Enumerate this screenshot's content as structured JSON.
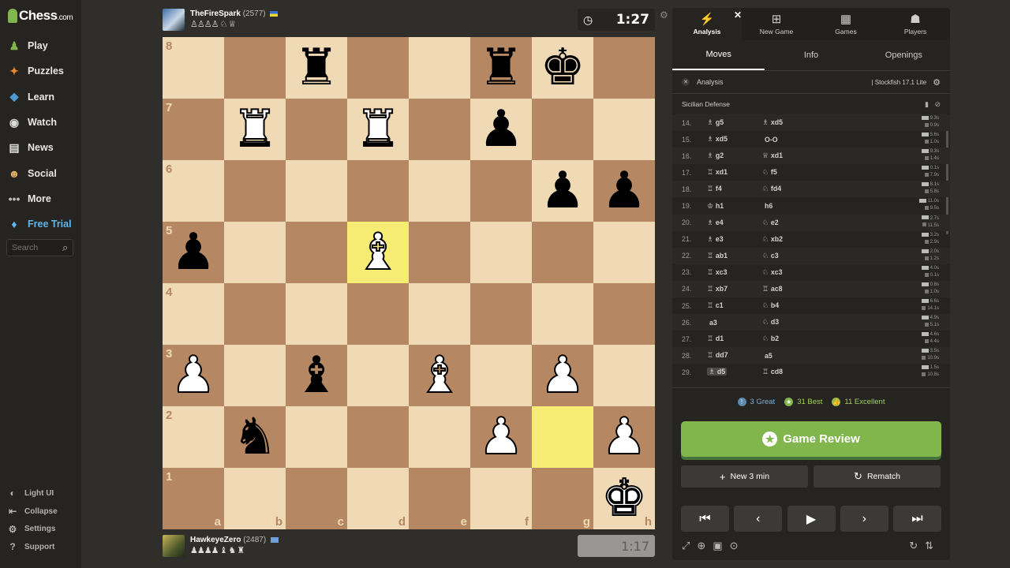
{
  "sidebar": {
    "logo": "Chess",
    "logo_domain": ".com",
    "items": [
      {
        "label": "Play",
        "icon": "play-icon"
      },
      {
        "label": "Puzzles",
        "icon": "puzzle-icon"
      },
      {
        "label": "Learn",
        "icon": "learn-icon"
      },
      {
        "label": "Watch",
        "icon": "binoculars-icon"
      },
      {
        "label": "News",
        "icon": "news-icon"
      },
      {
        "label": "Social",
        "icon": "social-icon"
      },
      {
        "label": "More",
        "icon": "more-icon"
      },
      {
        "label": "Free Trial",
        "icon": "diamond-icon"
      }
    ],
    "search_placeholder": "Search",
    "bottom": [
      {
        "label": "Light UI",
        "icon": "light-ui-icon"
      },
      {
        "label": "Collapse",
        "icon": "collapse-icon"
      },
      {
        "label": "Settings",
        "icon": "settings-icon"
      },
      {
        "label": "Support",
        "icon": "support-icon"
      }
    ]
  },
  "top_player": {
    "name": "TheFireSpark",
    "rating": "(2577)",
    "captures": "♙♙♙♙ ♘ ♕",
    "clock": "1:27"
  },
  "bottom_player": {
    "name": "HawkeyeZero",
    "rating": "(2487)",
    "captures": "♟♟♟♟ ♝ ♞ ♜",
    "clock": "1:17"
  },
  "board": {
    "ranks": [
      "8",
      "7",
      "6",
      "5",
      "4",
      "3",
      "2",
      "1"
    ],
    "files": [
      "a",
      "b",
      "c",
      "d",
      "e",
      "f",
      "g",
      "h"
    ],
    "highlight": [
      "d5",
      "g2"
    ],
    "pieces": {
      "c8": "bR",
      "f8": "bR",
      "g8": "bK",
      "b7": "wR",
      "d7": "wR",
      "f7": "bP",
      "g6": "bP",
      "h6": "bP",
      "a5": "bP",
      "d5": "wB",
      "a3": "wP",
      "c3": "bB",
      "e3": "wB",
      "g3": "wP",
      "b2": "bN",
      "f2": "wP",
      "h2": "wP",
      "h1": "wK"
    }
  },
  "panel": {
    "tabs": [
      {
        "label": "Analysis",
        "icon": "analysis-icon"
      },
      {
        "label": "New Game",
        "icon": "plus-icon"
      },
      {
        "label": "Games",
        "icon": "games-icon"
      },
      {
        "label": "Players",
        "icon": "players-icon"
      }
    ],
    "subtabs": [
      "Moves",
      "Info",
      "Openings"
    ],
    "engine_label": "Analysis",
    "engine_name": "Stockfish 17.1 Lite",
    "opening": "Sicilian Defense",
    "moves": [
      {
        "n": "14.",
        "w": "g5",
        "wp": "♗",
        "b": "xd5",
        "bp": "♗",
        "t1": "9.3s",
        "t2": "0.9s"
      },
      {
        "n": "15.",
        "w": "xd5",
        "wp": "♗",
        "b": "O-O",
        "bp": "",
        "t1": "5.6s",
        "t2": "1.0s"
      },
      {
        "n": "16.",
        "w": "g2",
        "wp": "♗",
        "b": "xd1",
        "bp": "♕",
        "t1": "9.3s",
        "t2": "1.4s"
      },
      {
        "n": "17.",
        "w": "xd1",
        "wp": "♖",
        "b": "f5",
        "bp": "♘",
        "t1": "0.1s",
        "t2": "7.9s"
      },
      {
        "n": "18.",
        "w": "f4",
        "wp": "♖",
        "b": "fd4",
        "bp": "♘",
        "t1": "8.1s",
        "t2": "5.8s"
      },
      {
        "n": "19.",
        "w": "h1",
        "wp": "♔",
        "b": "h6",
        "bp": "",
        "t1": "11.0s",
        "t2": "9.5s"
      },
      {
        "n": "20.",
        "w": "e4",
        "wp": "♗",
        "b": "e2",
        "bp": "♘",
        "t1": "2.7s",
        "t2": "11.5s"
      },
      {
        "n": "21.",
        "w": "e3",
        "wp": "♗",
        "b": "xb2",
        "bp": "♘",
        "t1": "3.2s",
        "t2": "2.9s"
      },
      {
        "n": "22.",
        "w": "ab1",
        "wp": "♖",
        "b": "c3",
        "bp": "♘",
        "t1": "2.0s",
        "t2": "1.2s"
      },
      {
        "n": "23.",
        "w": "xc3",
        "wp": "♖",
        "b": "xc3",
        "bp": "♘",
        "t1": "4.0s",
        "t2": "0.1s"
      },
      {
        "n": "24.",
        "w": "xb7",
        "wp": "♖",
        "b": "ac8",
        "bp": "♖",
        "t1": "0.8s",
        "t2": "1.0s"
      },
      {
        "n": "25.",
        "w": "c1",
        "wp": "♖",
        "b": "b4",
        "bp": "♘",
        "t1": "6.6s",
        "t2": "14.1s"
      },
      {
        "n": "26.",
        "w": "a3",
        "wp": "",
        "b": "d3",
        "bp": "♘",
        "t1": "4.9s",
        "t2": "5.1s"
      },
      {
        "n": "27.",
        "w": "d1",
        "wp": "♖",
        "b": "b2",
        "bp": "♘",
        "t1": "4.6s",
        "t2": "4.4s"
      },
      {
        "n": "28.",
        "w": "dd7",
        "wp": "♖",
        "b": "a5",
        "bp": "",
        "t1": "3.5s",
        "t2": "10.9s"
      },
      {
        "n": "29.",
        "w": "d5",
        "wp": "♗",
        "b": "cd8",
        "bp": "♖",
        "t1": "1.5s",
        "t2": "10.8s"
      }
    ],
    "stats": [
      {
        "label": "3 Great",
        "color": "#5c8bb0"
      },
      {
        "label": "31 Best",
        "color": "#81b64c"
      },
      {
        "label": "11 Excellent",
        "color": "#96bc4b"
      }
    ],
    "game_review": "Game Review",
    "new_game": "New 3 min",
    "rematch": "Rematch"
  }
}
